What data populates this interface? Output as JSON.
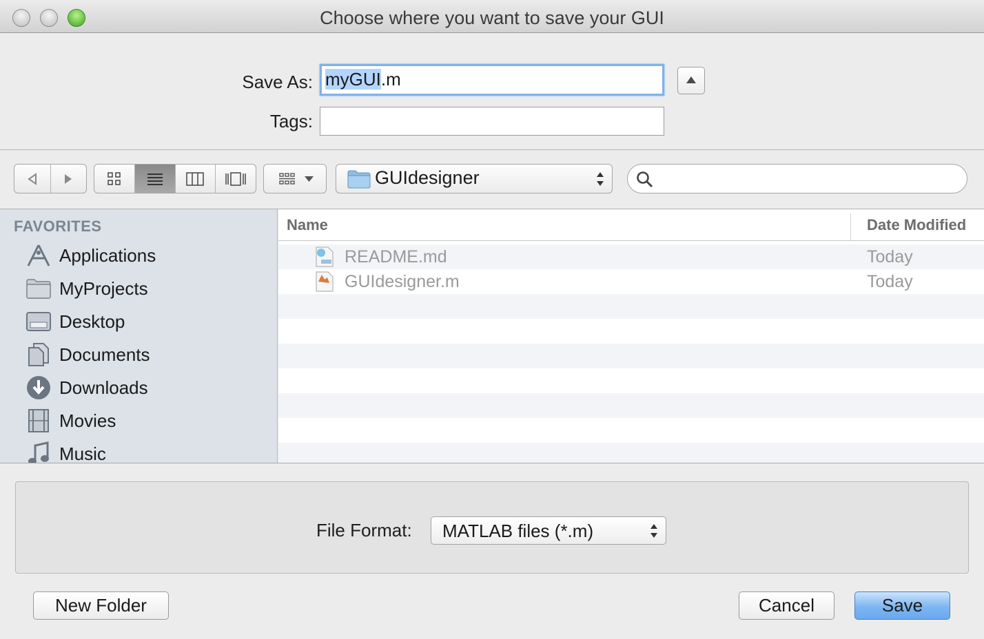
{
  "window": {
    "title": "Choose where you want to save your GUI"
  },
  "form": {
    "save_as_label": "Save As:",
    "save_as_value_selected": "myGUI",
    "save_as_value_rest": ".m",
    "tags_label": "Tags:",
    "tags_value": ""
  },
  "toolbar": {
    "location": "GUIdesigner"
  },
  "sidebar": {
    "heading": "FAVORITES",
    "items": [
      {
        "label": "Applications",
        "icon": "applications-icon"
      },
      {
        "label": "MyProjects",
        "icon": "folder-icon"
      },
      {
        "label": "Desktop",
        "icon": "desktop-icon"
      },
      {
        "label": "Documents",
        "icon": "documents-icon"
      },
      {
        "label": "Downloads",
        "icon": "downloads-icon"
      },
      {
        "label": "Movies",
        "icon": "movies-icon"
      },
      {
        "label": "Music",
        "icon": "music-icon"
      }
    ]
  },
  "file_list": {
    "col_name": "Name",
    "col_date": "Date Modified",
    "rows": [
      {
        "name": "README.md",
        "date": "Today"
      },
      {
        "name": "GUIdesigner.m",
        "date": "Today"
      }
    ]
  },
  "bottom": {
    "file_format_label": "File Format:",
    "file_format_value": "MATLAB files (*.m)",
    "new_folder": "New Folder",
    "cancel": "Cancel",
    "save": "Save"
  }
}
